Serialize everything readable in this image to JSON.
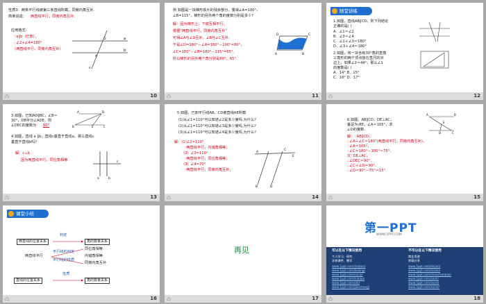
{
  "slides": [
    {
      "number": "10",
      "footer_left": "凸",
      "lines": [
        "性质3：两条平行线被第三条直线所截，同旁内角互补.",
        "简单说成：",
        "两直线平行，同旁内角互补.",
        "应用格式：",
        "∵a∥b（已知），",
        "∴∠2+∠4=180°",
        "（两直线平行，同旁内角互补）"
      ],
      "fig_labels": [
        "c",
        "2",
        "a",
        "4",
        "b"
      ]
    },
    {
      "number": "11",
      "footer_left": "凸",
      "lines": [
        "例  如图是一块梯形铁片的残余部分，量得∠A=100°，",
        "∠B=115°，梯形的另外两个角的度数分别是多少?",
        "解：因为梯形上、下底互相平行，",
        "根据“两直线平行，同旁内角互补”",
        "可得∠A与∠D互补，∠B与∠C互补.",
        "于是∠D=180°－∠A=180°－100°=80°，",
        "∠C=180°－∠B=180°－115°=65°.",
        "所以梯形的另外两个角分别是80°，65°."
      ],
      "fig_labels": [
        "D",
        "C",
        "A",
        "B"
      ]
    },
    {
      "number": "12",
      "footer_left": "凸",
      "header": "随堂训练",
      "lines": [
        "1.如图，直线AB∥CD，则下列结论",
        "正确的是(   )",
        "A．∠1＝∠2",
        "B．∠3＝∠4",
        "C．∠1＋∠3＝180°",
        "D．∠3＋∠4＝180°",
        "2.如图，将一块含有30°角的直角",
        "三角形的两个顶点放在直尺的对",
        "边上，如果∠2＝44°，那么∠1",
        "的度数是(   )",
        "A．14°        B．15°",
        "C．16°        D．17°"
      ]
    },
    {
      "number": "13",
      "footer_left": "凸",
      "lines": [
        "3.如图，已知AD∥BC，∠B＝",
        "30°，DB平分∠ADE，则",
        "∠DEC的度数为",
        "60°",
        "4.如图，直线 a ∥b，直线c垂直于直线a，那么直线c",
        "垂直于直线b吗?",
        "解：c⊥b",
        "因为两直线平行，同位角相等"
      ],
      "fig_labels": [
        "A",
        "D",
        "B",
        "E",
        "C",
        "c",
        "a",
        "b"
      ]
    },
    {
      "number": "14",
      "footer_left": "凸",
      "lines": [
        "5.如图，已知平行线AB、CD被直线AE所截",
        "(1)从∠1=110°可以知道∠2是多少度吗,为什么?",
        "(2)从∠1=110°可以知道∠3是多少度吗,为什么?",
        "(3)从∠1=110°可以知道∠4是多少度吗,为什么?",
        "解：(1)∠2=110°",
        "∵两直线平行，内错角相等；",
        "（2）∠3=110°",
        "∵两直线平行，同位角相等；",
        "（3）∠4=70°",
        "∵两直线平行，同旁内角互补；"
      ],
      "fig_labels": [
        "A",
        "B",
        "C",
        "D",
        "E"
      ]
    },
    {
      "number": "15",
      "footer_left": "凸",
      "lines": [
        "6.如图，AB∥CD，DE⊥AC，",
        "垂足为点E，∠A＝105°，求",
        "∠D的度数．",
        "解：∵AB∥CD，",
        "∴∠A＋∠C＝180°(两直线平行，同旁内角互补)．",
        "∵∠A＝105°，",
        "∴∠C＝180°－105°＝75°．",
        "又∵DE⊥AC，",
        "∴∠DEC＝90°．",
        "∴∠C＋∠D＝90°．",
        "∴∠D＝90°－75°＝15°."
      ],
      "fig_labels": [
        "A",
        "B",
        "E",
        "C",
        "D"
      ]
    },
    {
      "number": "16",
      "footer_left": "凸",
      "header": "课堂小结",
      "boxes": [
        "两直线的位置关系",
        "判定",
        "角的数量关系",
        "同位角相等",
        "两直线平行",
        "平行线的判定",
        "平行线的性质",
        "内错角相等",
        "同旁内角互补",
        "直线的位置关系",
        "性质",
        "角的数量关系"
      ]
    },
    {
      "number": "17",
      "footer_left": "凸",
      "title": "再见"
    },
    {
      "number": "18",
      "footer_left": "凸",
      "logo": "第一PPT",
      "url": "WWW.1PPT.COM",
      "col1_title": "可以在以下情况使用",
      "col2_title": "不可以在以下情况使用",
      "col1_items": [
        "个人学习、研究",
        "学校课件、教学",
        "www.1ppt.com/moban/",
        "www.1ppt.com/beijing/",
        "www.1ppt.com/sucai/",
        "www.1ppt.com/tubiao/",
        "www.1ppt.com/ziti/",
        "www.1ppt.com/jiaocheng/"
      ],
      "col2_items": [
        "商业用途",
        "转载分享",
        "www.1ppt.com/kejian/",
        "www.1ppt.com/xiazai/",
        "www.1ppt.com/shouchaobao/",
        "www.1ppt.com/jianli/",
        "www.1ppt.com/word/",
        "www.1ppt.com/excel/"
      ]
    }
  ]
}
